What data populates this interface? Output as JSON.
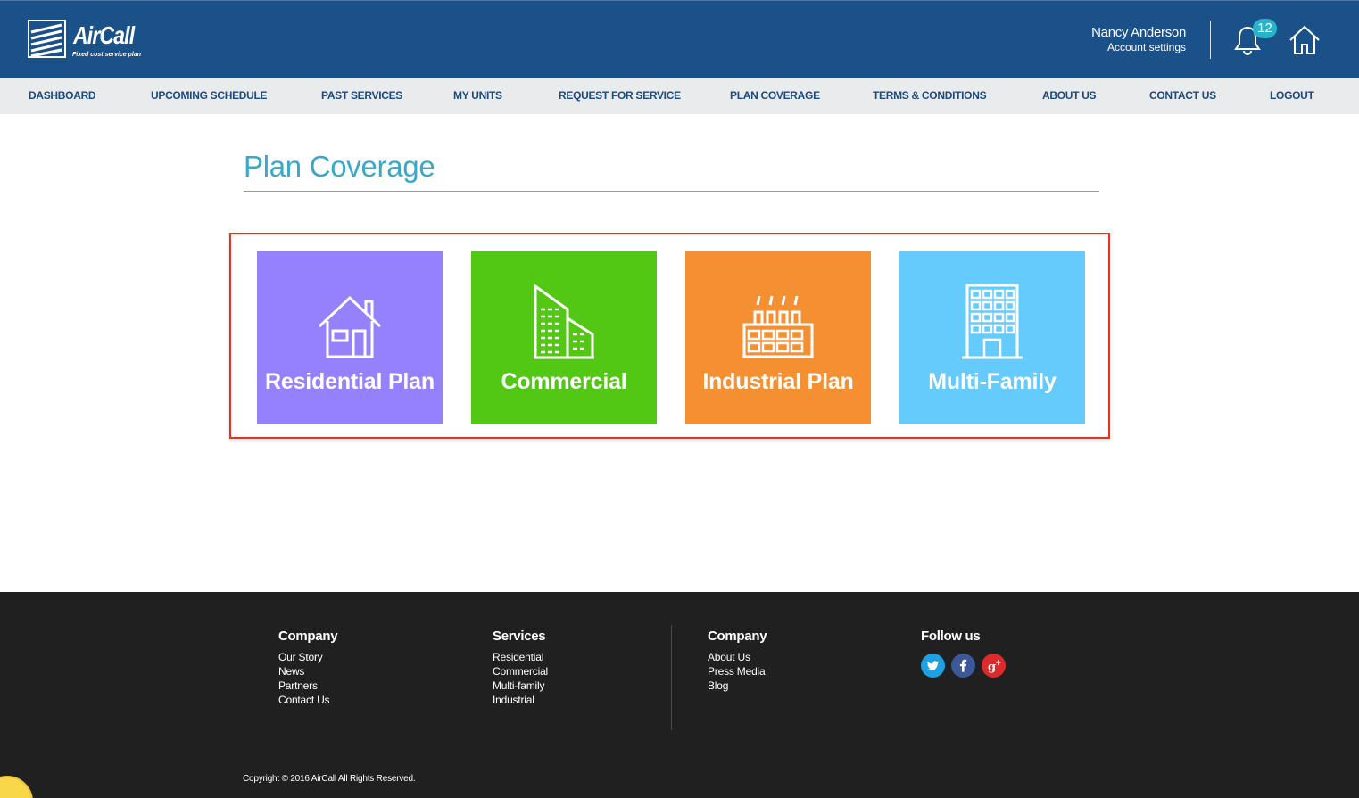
{
  "brand": {
    "name": "AirCall",
    "tagline": "Fixed cost service plan"
  },
  "user": {
    "name": "Nancy Anderson",
    "settings_label": "Account settings",
    "notification_count": "12"
  },
  "nav": {
    "items": [
      {
        "label": "DASHBOARD"
      },
      {
        "label": "UPCOMING SCHEDULE"
      },
      {
        "label": "PAST SERVICES"
      },
      {
        "label": "MY UNITS"
      },
      {
        "label": "REQUEST FOR SERVICE"
      },
      {
        "label": "PLAN COVERAGE"
      },
      {
        "label": "TERMS & CONDITIONS"
      },
      {
        "label": "ABOUT US"
      },
      {
        "label": "CONTACT US"
      },
      {
        "label": "LOGOUT"
      }
    ]
  },
  "main": {
    "title": "Plan Coverage",
    "plans": [
      {
        "label": "Residential Plan",
        "icon": "house-icon",
        "color": "#9481fb"
      },
      {
        "label": "Commercial",
        "icon": "office-buildings-icon",
        "color": "#53c814"
      },
      {
        "label": "Industrial Plan",
        "icon": "factory-icon",
        "color": "#f48f32"
      },
      {
        "label": "Multi-Family",
        "icon": "apartment-building-icon",
        "color": "#65cbfc"
      }
    ]
  },
  "footer": {
    "columns": [
      {
        "heading": "Company",
        "links": [
          "Our Story",
          "News",
          "Partners",
          "Contact Us"
        ]
      },
      {
        "heading": "Services",
        "links": [
          "Residential",
          "Commercial",
          "Multi-family",
          "Industrial"
        ]
      },
      {
        "heading": "Company",
        "links": [
          "About Us",
          "Press Media",
          "Blog"
        ]
      }
    ],
    "follow_heading": "Follow us",
    "social": [
      {
        "icon": "twitter-icon",
        "color": "#1da1e2"
      },
      {
        "icon": "facebook-icon",
        "color": "#3b5998"
      },
      {
        "icon": "google-plus-icon",
        "color": "#dd2a2a"
      }
    ],
    "copyright": "Copyright © 2016 AirCall All Rights Reserved."
  },
  "colors": {
    "header_bg": "#1a5189",
    "nav_bg": "#eaebed",
    "nav_text": "#1c4a7c",
    "title": "#3aa8c6",
    "highlight_border": "#e8311e",
    "footer_bg": "#202020",
    "badge": "#27b3c9"
  }
}
